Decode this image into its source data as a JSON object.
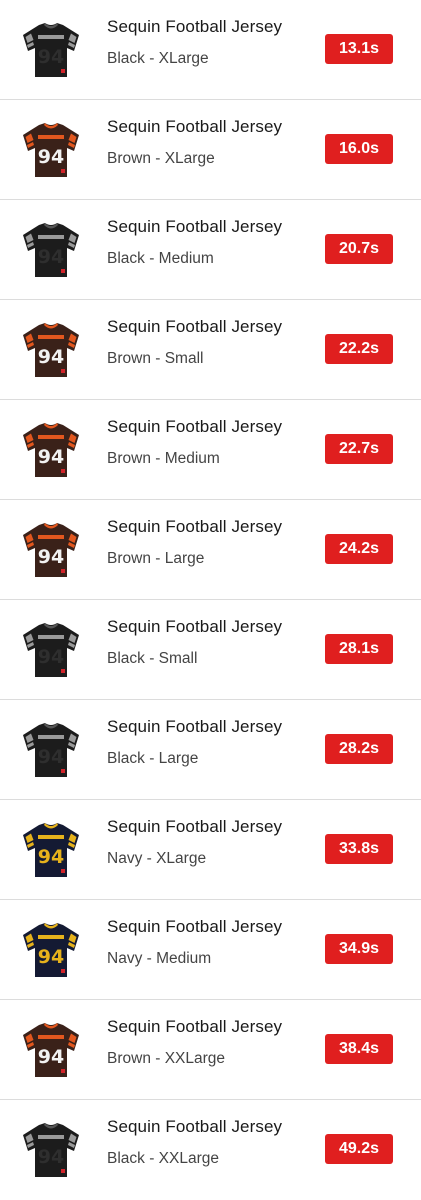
{
  "items": [
    {
      "title": "Sequin Football Jersey",
      "variant": "Black - XLarge",
      "time": "13.1s",
      "color": "black"
    },
    {
      "title": "Sequin Football Jersey",
      "variant": "Brown - XLarge",
      "time": "16.0s",
      "color": "brown"
    },
    {
      "title": "Sequin Football Jersey",
      "variant": "Black - Medium",
      "time": "20.7s",
      "color": "black"
    },
    {
      "title": "Sequin Football Jersey",
      "variant": "Brown - Small",
      "time": "22.2s",
      "color": "brown"
    },
    {
      "title": "Sequin Football Jersey",
      "variant": "Brown - Medium",
      "time": "22.7s",
      "color": "brown"
    },
    {
      "title": "Sequin Football Jersey",
      "variant": "Brown - Large",
      "time": "24.2s",
      "color": "brown"
    },
    {
      "title": "Sequin Football Jersey",
      "variant": "Black - Small",
      "time": "28.1s",
      "color": "black"
    },
    {
      "title": "Sequin Football Jersey",
      "variant": "Black - Large",
      "time": "28.2s",
      "color": "black"
    },
    {
      "title": "Sequin Football Jersey",
      "variant": "Navy - XLarge",
      "time": "33.8s",
      "color": "navy"
    },
    {
      "title": "Sequin Football Jersey",
      "variant": "Navy - Medium",
      "time": "34.9s",
      "color": "navy"
    },
    {
      "title": "Sequin Football Jersey",
      "variant": "Brown - XXLarge",
      "time": "38.4s",
      "color": "brown"
    },
    {
      "title": "Sequin Football Jersey",
      "variant": "Black - XXLarge",
      "time": "49.2s",
      "color": "black"
    }
  ],
  "jersey_number": "94",
  "palette": {
    "black": {
      "body": "#1c1c1c",
      "stripe": "#9a9a9a",
      "number": "#2e2e2e",
      "accent": "#555555"
    },
    "brown": {
      "body": "#3a2119",
      "stripe": "#e2571e",
      "number": "#f2f2f2",
      "accent": "#e2571e"
    },
    "navy": {
      "body": "#141a33",
      "stripe": "#e6b21c",
      "number": "#e6b21c",
      "accent": "#e6b21c"
    }
  },
  "badge_color": "#e01f1f"
}
